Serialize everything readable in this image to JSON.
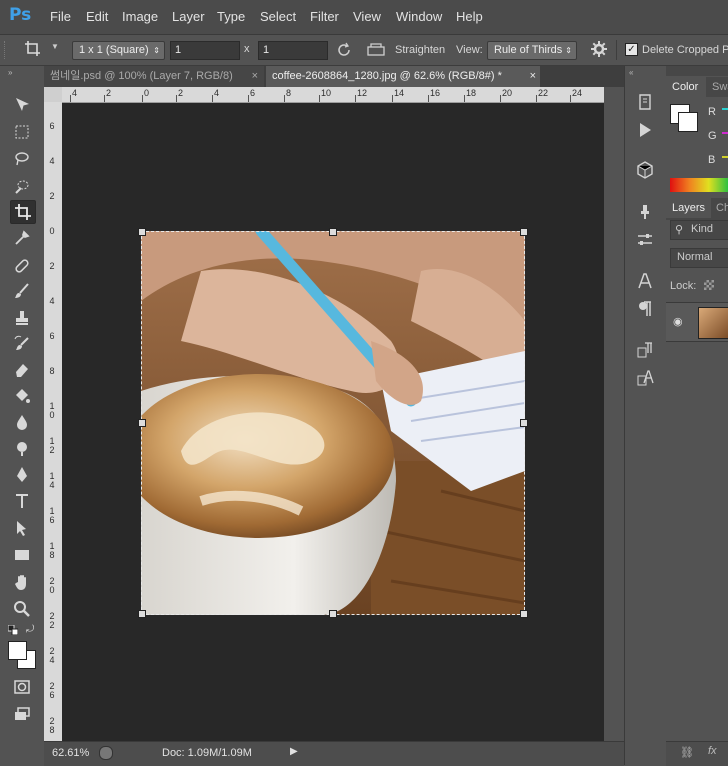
{
  "app": {
    "logo": "Ps"
  },
  "menu": [
    "File",
    "Edit",
    "Image",
    "Layer",
    "Type",
    "Select",
    "Filter",
    "View",
    "Window",
    "Help"
  ],
  "options": {
    "ratio": "1 x 1 (Square)",
    "width_value": "1",
    "x_sep": "x",
    "height_value": "1",
    "straighten": "Straighten",
    "view_label": "View:",
    "view_value": "Rule of Thirds",
    "delete_cropped": "Delete Cropped Pix",
    "delete_cropped_checked": true
  },
  "tabs": [
    {
      "label": "썸네일.psd @ 100% (Layer 7, RGB/8)",
      "close": "×",
      "active": false
    },
    {
      "label": "coffee-2608864_1280.jpg @ 62.6% (RGB/8#) *",
      "close": "×",
      "active": true
    }
  ],
  "ruler": {
    "h_ticks": [
      "4",
      "2",
      "0",
      "2",
      "4",
      "6",
      "8",
      "10",
      "12",
      "14",
      "16",
      "18",
      "20",
      "22",
      "24"
    ],
    "v_ticks": [
      "6",
      "4",
      "2",
      "0",
      "2",
      "4",
      "6",
      "8",
      "10",
      "12",
      "14",
      "16",
      "18",
      "20",
      "22",
      "24",
      "26",
      "28"
    ]
  },
  "status": {
    "zoom": "62.61%",
    "doc": "Doc: 1.09M/1.09M"
  },
  "panels": {
    "color_tab": "Color",
    "swatches_tab": "Swa",
    "color_r": "R",
    "color_g": "G",
    "color_b": "B",
    "layers_tab": "Layers",
    "channels_tab": "Cha",
    "kind": "Kind",
    "blend": "Normal",
    "lock": "Lock:"
  },
  "colors": {
    "accent": "#3fa0e8",
    "canvas": "#282828",
    "panel": "#535353"
  }
}
